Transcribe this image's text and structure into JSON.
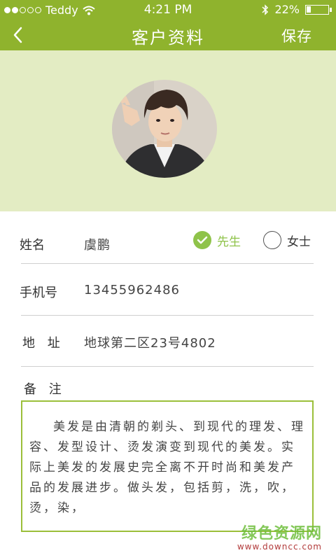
{
  "status_bar": {
    "carrier": "Teddy",
    "time": "4:21 PM",
    "battery": "22%",
    "battery_level": 0.22,
    "signal_bars": 2,
    "signal_total": 5
  },
  "nav": {
    "title": "客户资料",
    "save_label": "保存",
    "back_icon": "chevron-left-icon"
  },
  "colors": {
    "accent": "#8fb32d",
    "avatar_bg": "#e3ecc3",
    "check": "#8fc34a"
  },
  "form": {
    "name_label": "姓名",
    "name_value": "虞鹏",
    "gender_male": "先生",
    "gender_female": "女士",
    "gender_selected": "先生",
    "phone_label": "手机号",
    "phone_value": "13455962486",
    "address_label": "地 址",
    "address_value": "地球第二区23号4802",
    "notes_label": "备 注",
    "notes_value": "美发是由清朝的剃头、到现代的理发、理容、发型设计、烫发演变到现代的美发。实际上美发的发展史完全离不开时尚和美发产品的发展进步。做头发，包括剪，洗，吹，烫，染，"
  },
  "watermark": {
    "main": "绿色资源网",
    "sub": "www.downcc.com"
  }
}
